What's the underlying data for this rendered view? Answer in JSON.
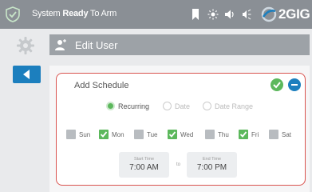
{
  "statusbar": {
    "status_prefix": "System ",
    "status_bold": "Ready",
    "status_suffix": " To Arm",
    "brand": "2GIG"
  },
  "header": {
    "title": "Edit User"
  },
  "schedule": {
    "title": "Add Schedule",
    "modes": [
      {
        "label": "Recurring",
        "selected": true
      },
      {
        "label": "Date",
        "selected": false
      },
      {
        "label": "Date Range",
        "selected": false
      }
    ],
    "days": [
      {
        "label": "Sun",
        "checked": false
      },
      {
        "label": "Mon",
        "checked": true
      },
      {
        "label": "Tue",
        "checked": false
      },
      {
        "label": "Wed",
        "checked": true
      },
      {
        "label": "Thu",
        "checked": false
      },
      {
        "label": "Fri",
        "checked": true
      },
      {
        "label": "Sat",
        "checked": false
      }
    ],
    "start_label": "Start Time",
    "start_value": "7:00 AM",
    "separator": "to",
    "end_label": "End Time",
    "end_value": "7:00 PM"
  },
  "colors": {
    "accent": "#1c7fbe",
    "ok": "#5cb85c",
    "border": "#d9534f"
  }
}
